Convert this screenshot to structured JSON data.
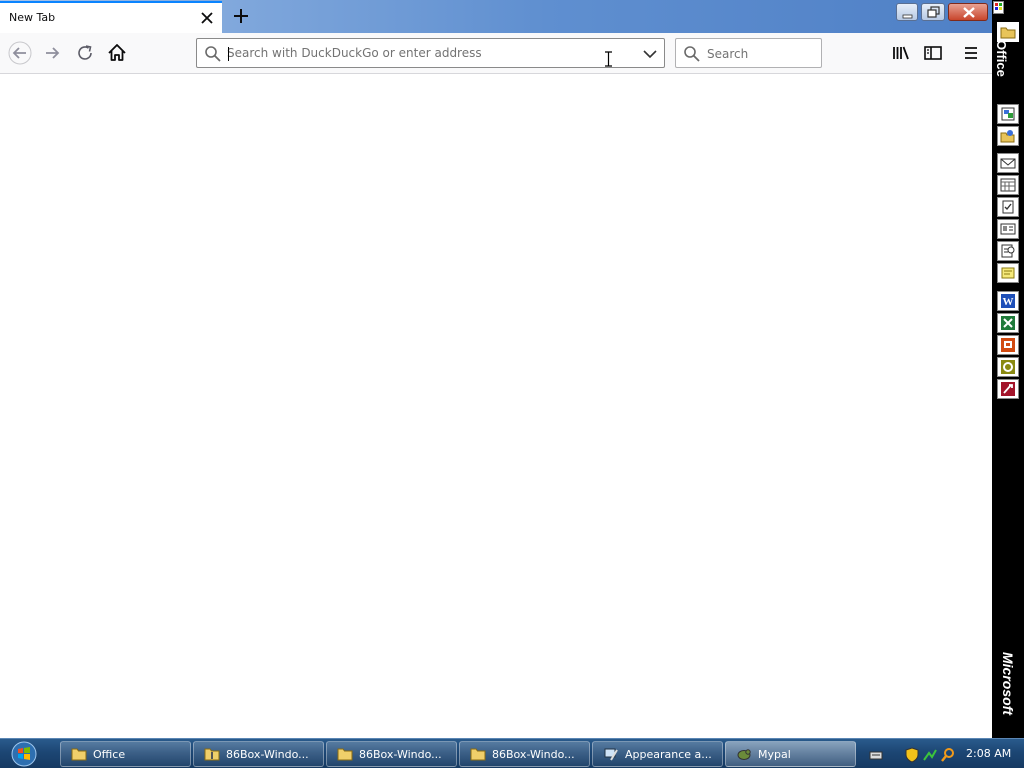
{
  "browser": {
    "tab": {
      "title": "New Tab"
    },
    "urlbar": {
      "placeholder": "Search with DuckDuckGo or enter address"
    },
    "searchbar": {
      "placeholder": "Search"
    }
  },
  "officebar": {
    "label": "Office",
    "brand": "Microsoft",
    "icons": [
      "new-office-document-icon",
      "open-office-document-icon",
      "new-message-icon",
      "new-appointment-icon",
      "new-task-icon",
      "new-contact-icon",
      "new-journal-entry-icon",
      "new-note-icon",
      "word-icon",
      "excel-icon",
      "powerpoint-icon",
      "publisher-icon",
      "access-icon"
    ]
  },
  "taskbar": {
    "items": [
      {
        "label": "Office",
        "icon": "folder-icon"
      },
      {
        "label": "86Box-Windo...",
        "icon": "archive-folder-icon"
      },
      {
        "label": "86Box-Windo...",
        "icon": "folder-icon"
      },
      {
        "label": "86Box-Windo...",
        "icon": "folder-icon"
      },
      {
        "label": "Appearance a...",
        "icon": "display-settings-icon"
      },
      {
        "label": "Mypal",
        "icon": "mypal-icon"
      }
    ],
    "clock": "2:08 AM"
  },
  "colors": {
    "accent": "#0a84ff",
    "taskbar": "#1c4674",
    "close_button": "#c8452c"
  }
}
